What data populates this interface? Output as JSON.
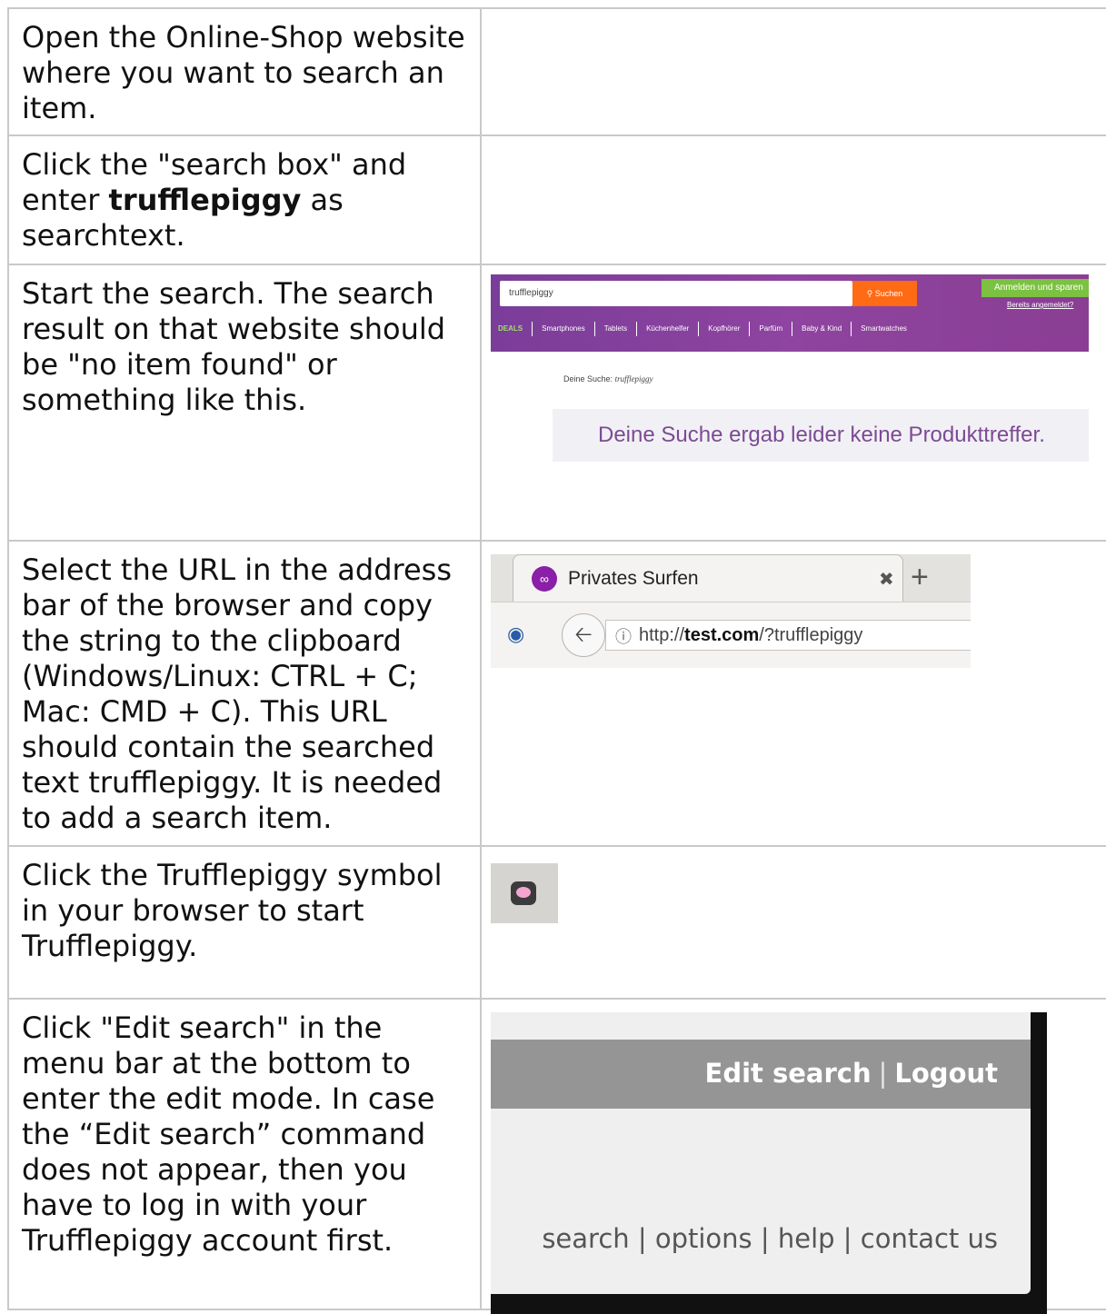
{
  "steps": [
    {
      "text": "Open the Online-Shop website where you want to search an item."
    },
    {
      "text_before": "Click the \"search box\" and enter ",
      "bold": "trufflepiggy",
      "text_after": " as searchtext."
    },
    {
      "text": "Start the search. The search result on that website should be \"no item found\" or something like this."
    },
    {
      "text": "Select the URL in the address bar of the browser and copy the string to the clipboard (Windows/Linux: CTRL + C; Mac: CMD + C). This URL should contain the searched text trufflepiggy. It is needed to add a search item."
    },
    {
      "text": "Click the Trufflepiggy symbol in your browser to start Trufflepiggy."
    },
    {
      "text": "Click \"Edit search\" in the menu bar at the bottom to enter the edit mode. In case the “Edit search” command does not appear, then you have to log in with your Trufflepiggy account first."
    }
  ],
  "shop": {
    "search_value": "trufflepiggy",
    "search_button": "Suchen",
    "login_button": "Anmelden und sparen",
    "logged_in_link": "Bereits angemeldet?",
    "nav": [
      "DEALS",
      "Smartphones",
      "Tablets",
      "Küchenhelfer",
      "Kopfhörer",
      "Parfüm",
      "Baby & Kind",
      "Smartwatches"
    ],
    "your_search_label": "Deine Suche:",
    "your_search_term": "trufflepiggy",
    "no_results": "Deine Suche ergab leider keine Produkttreffer.",
    "colors": {
      "header": "#8e44a0",
      "search_button": "#ff6a14",
      "login": "#7cc142",
      "result_text": "#7d4a94"
    }
  },
  "browser": {
    "tab_title": "Privates Surfen",
    "url_scheme": "http://",
    "url_host": "test.com",
    "url_path": "/?trufflepiggy"
  },
  "menu": {
    "edit_search": "Edit search",
    "separator": "|",
    "logout": "Logout",
    "footer": "search | options | help | contact us"
  }
}
